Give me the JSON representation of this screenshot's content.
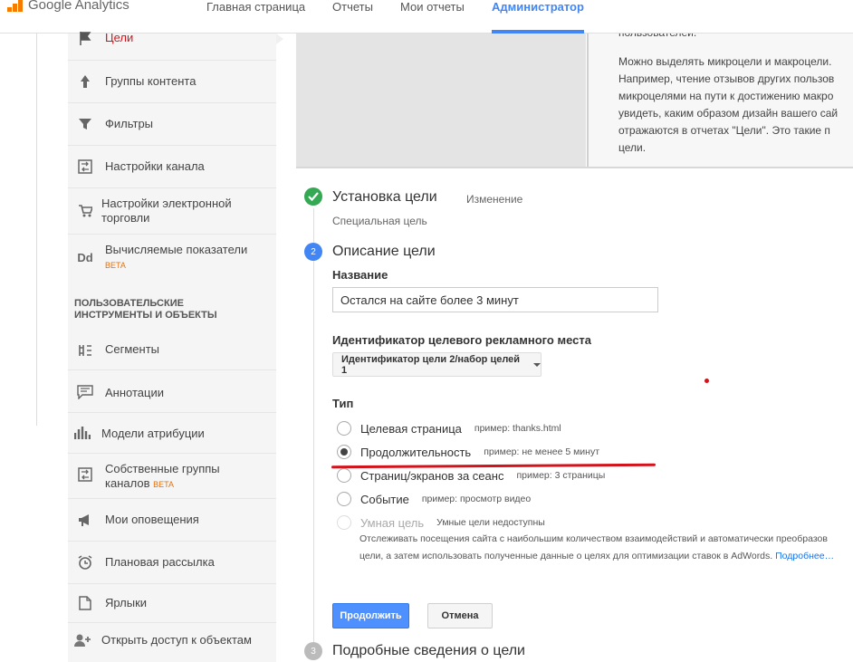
{
  "header": {
    "logo_text": "Google Analytics",
    "nav": [
      "Главная страница",
      "Отчеты",
      "Мои отчеты",
      "Администратор"
    ],
    "active_tab": "Администратор"
  },
  "sidebar": {
    "items": [
      {
        "label": "Цели",
        "icon": "flag-icon",
        "active": true
      },
      {
        "label": "Группы контента",
        "icon": "content-grouping-icon"
      },
      {
        "label": "Фильтры",
        "icon": "filter-icon"
      },
      {
        "label": "Настройки канала",
        "icon": "channel-settings-icon"
      },
      {
        "label": "Настройки электронной",
        "label2": "торговли",
        "icon": "cart-icon"
      },
      {
        "label": "Вычисляемые показатели",
        "badge": "BETA",
        "icon": "dd-icon",
        "icon_text": "Dd"
      }
    ],
    "section_heading_line1": "ПОЛЬЗОВАТЕЛЬСКИЕ",
    "section_heading_line2": "ИНСТРУМЕНТЫ И ОБЪЕКТЫ",
    "tools": [
      {
        "label": "Сегменты",
        "icon": "segments-icon"
      },
      {
        "label": "Аннотации",
        "icon": "annotation-icon"
      },
      {
        "label": "Модели атрибуции",
        "icon": "attribution-icon"
      },
      {
        "label": "Собственные группы",
        "label2": "каналов",
        "badge": "BETA",
        "icon": "custom-channel-icon"
      },
      {
        "label": "Мои оповещения",
        "icon": "megaphone-icon"
      },
      {
        "label": "Плановая рассылка",
        "icon": "alarm-clock-icon"
      },
      {
        "label": "Ярлыки",
        "icon": "shortcut-icon"
      },
      {
        "label": "Открыть доступ к объектам",
        "icon": "share-user-icon"
      }
    ]
  },
  "help_panel": {
    "lines": [
      "пользователей.",
      "",
      "Можно выделять микроцели и макроцели.",
      "Например, чтение отзывов других пользов",
      "микроцелями на пути к достижению макро",
      "увидеть, каким образом дизайн вашего сай",
      "отражаются в отчетах \"Цели\". Это такие п",
      "цели."
    ]
  },
  "steps": {
    "step1": {
      "title": "Установка цели",
      "action": "Изменение",
      "subtitle": "Специальная цель"
    },
    "step2": {
      "number": "2",
      "title": "Описание цели"
    },
    "step3": {
      "number": "3",
      "title": "Подробные сведения о цели"
    }
  },
  "form": {
    "name_label": "Название",
    "name_value": "Остался на сайте более 3 минут",
    "slot_label": "Идентификатор целевого рекламного места",
    "slot_value": "Идентификатор цели 2/набор целей 1",
    "type_label": "Тип",
    "types": [
      {
        "label": "Целевая страница",
        "hint": "пример: thanks.html",
        "checked": false
      },
      {
        "label": "Продолжительность",
        "hint": "пример: не менее 5 минут",
        "checked": true
      },
      {
        "label": "Страниц/экранов за сеанс",
        "hint": "пример: 3 страницы",
        "checked": false
      },
      {
        "label": "Событие",
        "hint": "пример: просмотр видео",
        "checked": false
      },
      {
        "label": "Умная цель",
        "hint": "Умные цели недоступны",
        "checked": false,
        "disabled": true
      }
    ],
    "smart_desc_line1": "Отслеживать посещения сайта с наибольшим количеством взаимодействий и автоматически преобразов",
    "smart_desc_line2": "цели, а затем использовать полученные данные о целях для оптимизации ставок в AdWords.",
    "smart_desc_link": "Подробнее…"
  },
  "buttons": {
    "continue": "Продолжить",
    "cancel": "Отмена"
  },
  "colors": {
    "accent": "#4285f4",
    "success": "#34a853",
    "annotation_red": "#d3131b",
    "logo": "#f57c00"
  }
}
